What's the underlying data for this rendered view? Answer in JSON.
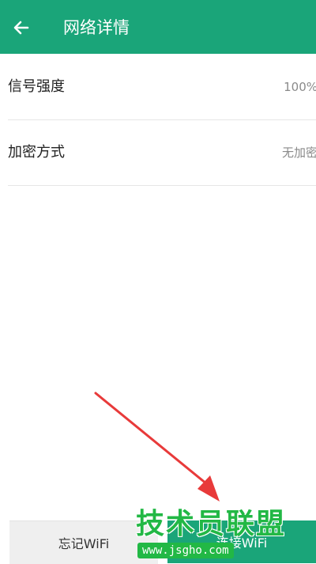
{
  "header": {
    "title": "网络详情",
    "back_icon": "arrow-left-icon",
    "background_color": "#1aa579"
  },
  "details": [
    {
      "label": "信号强度",
      "value": "100%"
    },
    {
      "label": "加密方式",
      "value": "无加密"
    }
  ],
  "actions": {
    "forget_label": "忘记WiFi",
    "connect_label": "连接WiFi"
  },
  "annotation": {
    "arrow_color": "#e83a3a"
  },
  "watermark": {
    "text": "技术员联盟",
    "url": "www.jsgho.com",
    "color": "#22b845"
  }
}
